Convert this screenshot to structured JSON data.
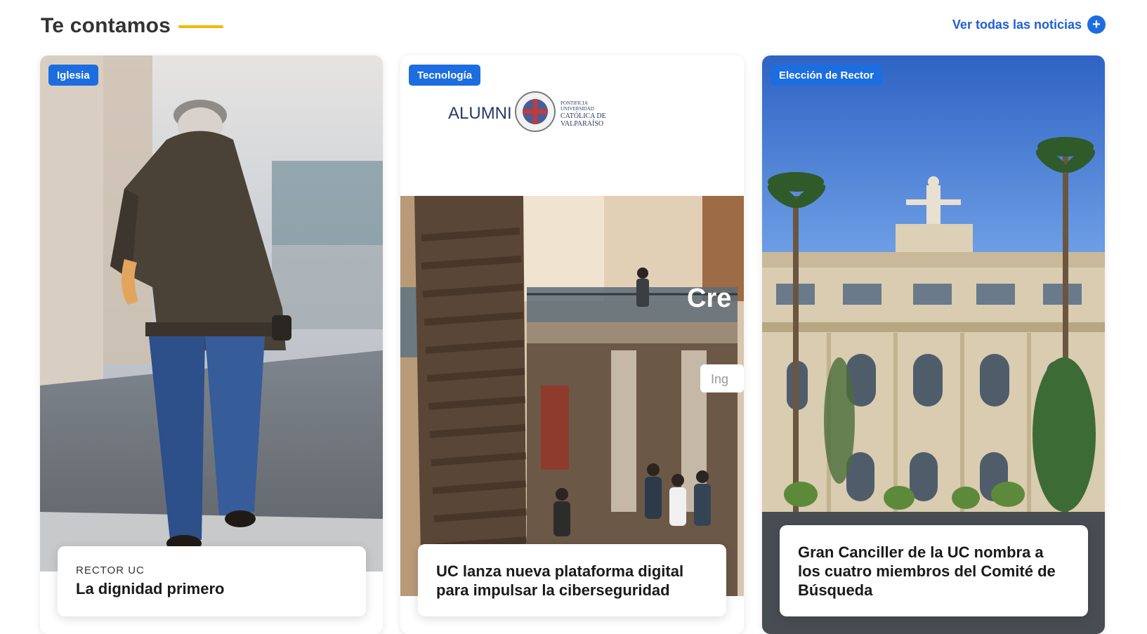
{
  "section": {
    "title": "Te contamos",
    "see_all_label": "Ver todas las noticias",
    "accent_color": "#f5b800",
    "link_color": "#1f5fd0"
  },
  "cards": [
    {
      "badge": "Iglesia",
      "kicker": "RECTOR UC",
      "headline": "La dignidad primero",
      "image": "elderly-man-walking-photo"
    },
    {
      "badge": "Tecnología",
      "kicker": "",
      "headline": "UC lanza nueva plataforma digital para impulsar la ciberseguridad",
      "image": "alumni-pucv-campus-photo",
      "image_text": {
        "alumni": "ALUMNI",
        "seal_line1": "PONTIFICIA",
        "seal_line2": "UNIVERSIDAD",
        "seal_line3": "CATÓLICA DE",
        "seal_line4": "VALPARAÍSO",
        "overlay_text": "Cre",
        "input_fragment": "Ing"
      }
    },
    {
      "badge": "Elección de Rector",
      "kicker": "",
      "headline": "Gran Canciller de la UC nombra a los cuatro miembros del Comité de Búsqueda",
      "image": "university-building-palms-photo"
    }
  ],
  "badge_color": "#1c6de0"
}
